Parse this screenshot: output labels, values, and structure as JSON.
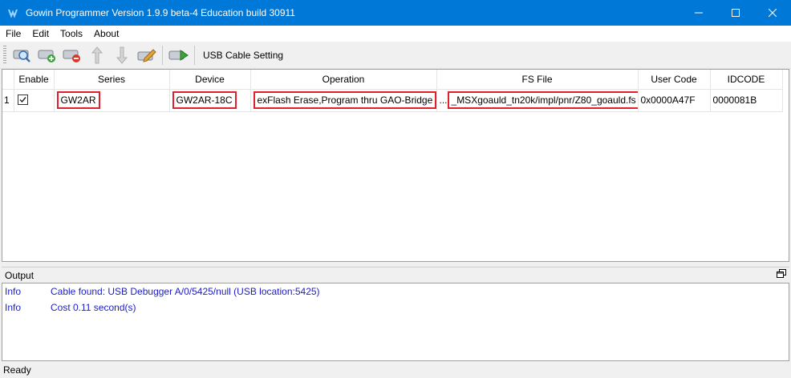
{
  "window": {
    "title": "Gowin Programmer Version 1.9.9 beta-4 Education build 30911",
    "icon": "gowin-logo-icon"
  },
  "menu": [
    "File",
    "Edit",
    "Tools",
    "About"
  ],
  "toolbar": {
    "buttons": [
      "scan-device-icon",
      "add-device-icon",
      "remove-device-icon",
      "move-up-icon",
      "move-down-icon",
      "edit-icon",
      "program-icon"
    ],
    "usb_label": "USB Cable Setting"
  },
  "table": {
    "columns": [
      "",
      "Enable",
      "Series",
      "Device",
      "Operation",
      "FS File",
      "User Code",
      "IDCODE"
    ],
    "rows": [
      {
        "num": "1",
        "enabled": true,
        "series": "GW2AR",
        "device": "GW2AR-18C",
        "operation": "exFlash Erase,Program thru GAO-Bridge",
        "fs_prefix": "...",
        "fs_file": "_MSXgoauld_tn20k/impl/pnr/Z80_goauld.fs",
        "user_code": "0x0000A47F",
        "idcode": "0000081B"
      }
    ]
  },
  "output": {
    "title": "Output",
    "logs": [
      {
        "level": "Info",
        "message": "Cable found:  USB Debugger A/0/5425/null (USB location:5425)"
      },
      {
        "level": "Info",
        "message": "Cost 0.11 second(s)"
      }
    ]
  },
  "status": "Ready",
  "colors": {
    "titlebar": "#0078d7",
    "highlight": "#e0202a",
    "log_text": "#1c1cc8"
  }
}
